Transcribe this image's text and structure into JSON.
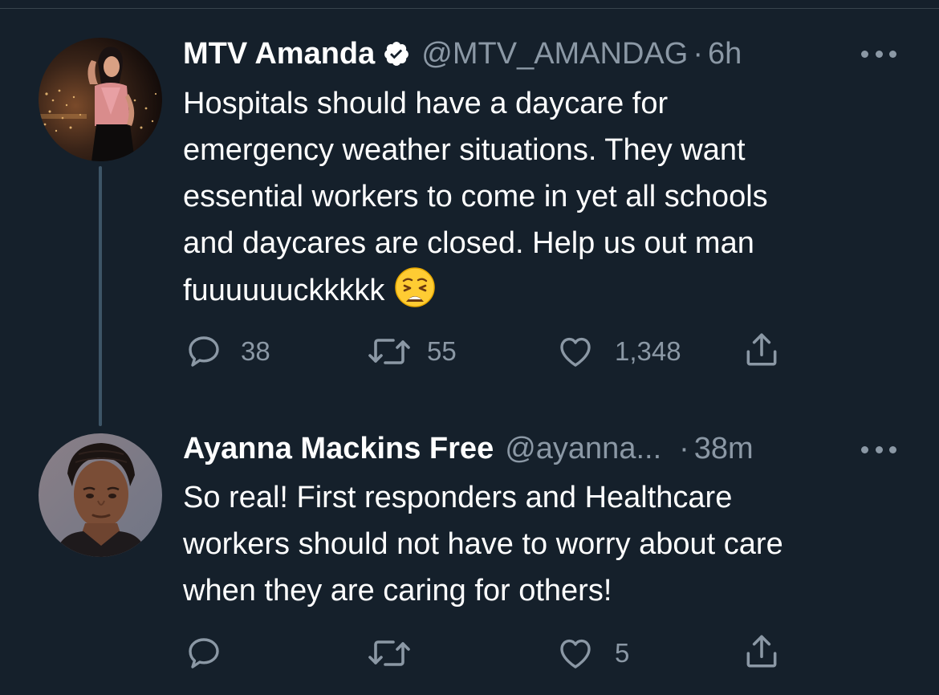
{
  "tweets": [
    {
      "name": "MTV Amanda",
      "verified": true,
      "handle": "@MTV_AMANDAG",
      "separator": "·",
      "time": "6h",
      "text": "Hospitals should have a daycare for\nemergency weather situations. They want\nessential workers to come in yet all schools\nand daycares are closed. Help us out man\nfuuuuuuckkkkk",
      "emoji": "weary-face-emoji",
      "actions": {
        "replies": "38",
        "retweets": "55",
        "likes": "1,348"
      }
    },
    {
      "name": "Ayanna Mackins Free",
      "verified": false,
      "handle": "@ayanna...",
      "separator": "·",
      "time": "38m",
      "text": "So real! First responders and Healthcare\nworkers should not have to worry about care\nwhen they are caring for others!",
      "actions": {
        "replies": "",
        "retweets": "",
        "likes": "5"
      }
    }
  ],
  "colors": {
    "background": "#15202b",
    "text_primary": "#ffffff",
    "text_secondary": "#8b98a5",
    "thread_line": "#3d5466"
  }
}
